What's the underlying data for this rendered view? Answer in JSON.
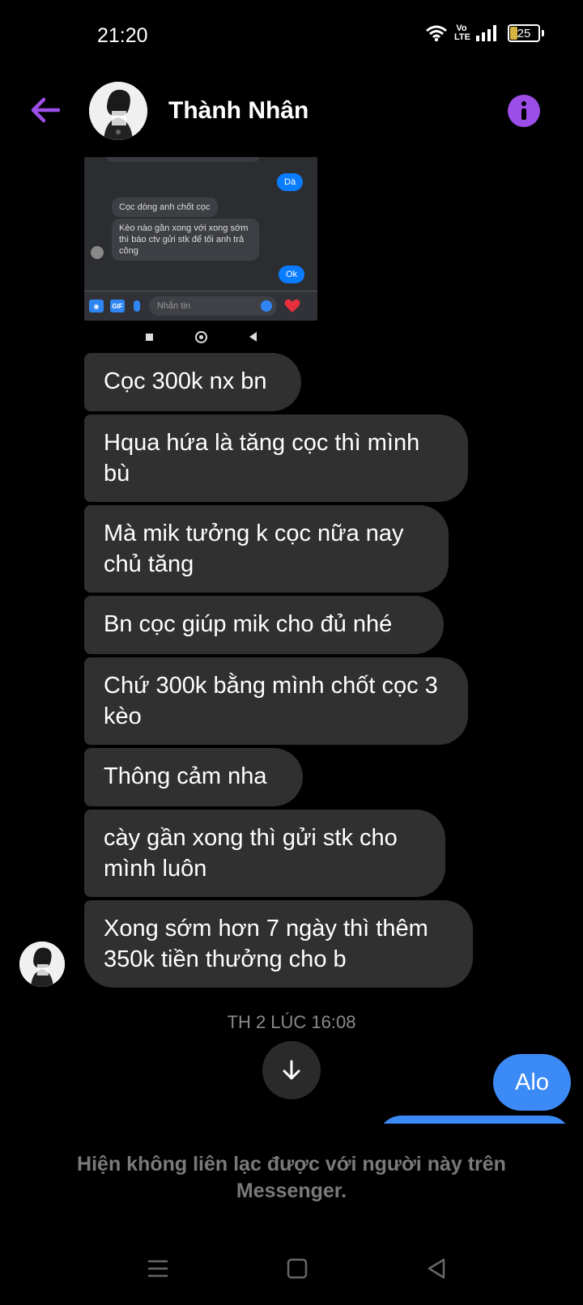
{
  "status_bar": {
    "time": "21:20",
    "network": "Vo LTE",
    "battery": "25",
    "icons": [
      "wifi-icon",
      "signal-icon",
      "battery-icon"
    ]
  },
  "header": {
    "contact_name": "Thành Nhân",
    "back_icon": "arrow-left-icon",
    "info_icon": "info-icon",
    "accent_color": "#9c4ee8"
  },
  "image_message": {
    "bubble_da": "Dà",
    "bubble_1": "Cọc dòng anh chốt cọc",
    "bubble_2": "Kèo nào gần xong với xong sớm thì báo ctv gửi stk để tối anh trả công",
    "bubble_ok": "Ok",
    "input_placeholder": "Nhắn tin",
    "gif_label": "GIF"
  },
  "messages": [
    "Cọc 300k nx bn",
    "Hqua hứa là tăng cọc thì mình bù",
    "Mà mik tưởng k cọc nữa nay chủ tăng",
    "Bn cọc giúp mik cho đủ nhé",
    "Chứ 300k bằng mình chốt cọc 3 kèo",
    "Thông cảm nha",
    "cày gần xong thì gửi stk cho mình luôn",
    "Xong sớm hơn 7 ngày thì thêm 350k tiền thưởng cho b"
  ],
  "timestamp": "TH 2 LÚC 16:08",
  "sent_message": "Alo",
  "unavailable_notice": "Hiện không liên lạc được với người này trên Messenger.",
  "colors": {
    "received_bubble": "#303030",
    "sent_bubble": "#3b8af5",
    "background": "#000000"
  }
}
